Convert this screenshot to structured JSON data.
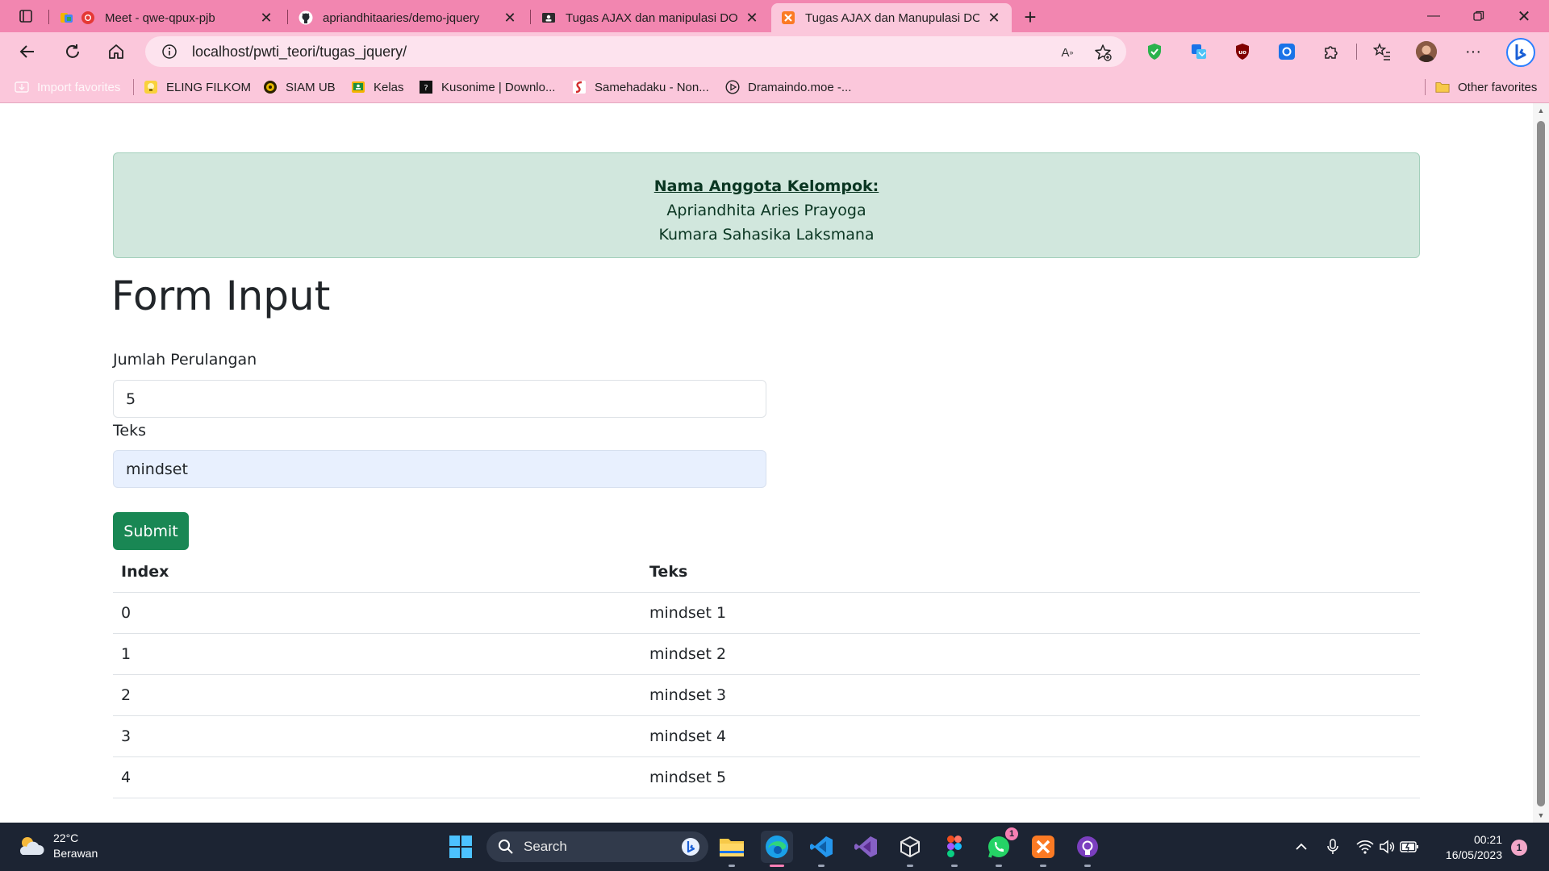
{
  "browser": {
    "tabs": [
      {
        "title": "Meet - qwe-qpux-pjb",
        "icon": "meet-icon",
        "active": false
      },
      {
        "title": "apriandhitaaries/demo-jquery",
        "icon": "github-icon",
        "active": false
      },
      {
        "title": "Tugas AJAX dan manipulasi DOM",
        "icon": "classroom-icon",
        "active": false
      },
      {
        "title": "Tugas AJAX dan Manupulasi DOM",
        "icon": "xampp-icon",
        "active": true
      }
    ],
    "address": "localhost/pwti_teori/tugas_jquery/",
    "favorites": [
      {
        "label": "Import favorites",
        "icon": "import-icon",
        "muted": true
      },
      {
        "label": "ELING FILKOM",
        "icon": "bulb-icon"
      },
      {
        "label": "SIAM UB",
        "icon": "ub-logo-icon"
      },
      {
        "label": "Kelas",
        "icon": "classroom-icon"
      },
      {
        "label": "Kusonime | Downlo...",
        "icon": "kusonime-icon"
      },
      {
        "label": "Samehadaku - Non...",
        "icon": "samehadaku-icon"
      },
      {
        "label": "Dramaindo.moe -...",
        "icon": "play-circle-icon"
      }
    ],
    "other_favorites": "Other favorites"
  },
  "colors": {
    "tabstrip": "#f286b0",
    "toolbar": "#fbc7db",
    "alert_bg": "#d1e7dd",
    "submit_bg": "#198754",
    "taskbar": "#1c2433"
  },
  "page": {
    "alert": {
      "heading": "Nama Anggota Kelompok:",
      "members": [
        "Apriandhita Aries Prayoga",
        "Kumara Sahasika Laksmana"
      ]
    },
    "title": "Form Input",
    "form": {
      "loop_label": "Jumlah Perulangan",
      "loop_value": "5",
      "text_label": "Teks",
      "text_value": "mindset",
      "submit_label": "Submit"
    },
    "table": {
      "headers": [
        "Index",
        "Teks"
      ],
      "rows": [
        [
          "0",
          "mindset 1"
        ],
        [
          "1",
          "mindset 2"
        ],
        [
          "2",
          "mindset 3"
        ],
        [
          "3",
          "mindset 4"
        ],
        [
          "4",
          "mindset 5"
        ]
      ]
    }
  },
  "taskbar": {
    "weather_temp": "22°C",
    "weather_desc": "Berawan",
    "search_label": "Search",
    "time": "00:21",
    "date": "16/05/2023",
    "notification_count": "1",
    "whatsapp_badge": "1"
  }
}
